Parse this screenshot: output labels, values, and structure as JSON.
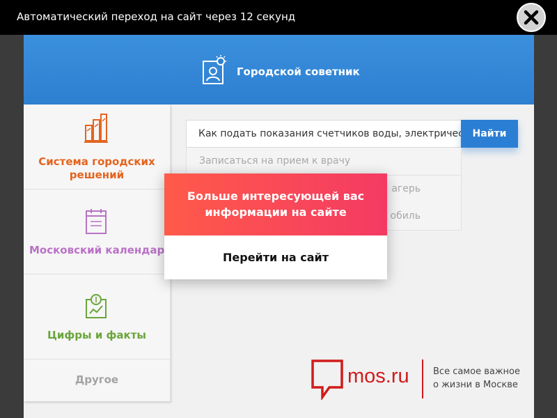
{
  "topbar": {
    "message": "Автоматический переход на сайт через 12 секунд",
    "close_icon": "close-icon"
  },
  "header": {
    "title": "Городской советник",
    "icon": "advisor-lightbulb-icon"
  },
  "sidebar": {
    "items": [
      {
        "label": "Система городских решений",
        "icon": "city-buildings-icon",
        "color": "#e4641f"
      },
      {
        "label": "Московский календарь",
        "icon": "calendar-icon",
        "color": "#b971c6"
      },
      {
        "label": "Цифры и факты",
        "icon": "facts-coins-icon",
        "color": "#6aa53b"
      },
      {
        "label": "Другое",
        "color": "#a3a3a3"
      }
    ]
  },
  "search": {
    "value": "Как подать показания счетчиков воды, электричества",
    "button_label": "Найти",
    "suggestions": [
      "Записаться на прием к врачу",
      "агерь",
      "обиль"
    ]
  },
  "modal": {
    "message": "Больше интересующей вас информации на сайте",
    "button_label": "Перейти на сайт"
  },
  "footer_brand": {
    "name": "mos.ru",
    "tagline_line1": "Все самое важное",
    "tagline_line2": "о жизни в Москве",
    "color": "#d11b1b"
  }
}
